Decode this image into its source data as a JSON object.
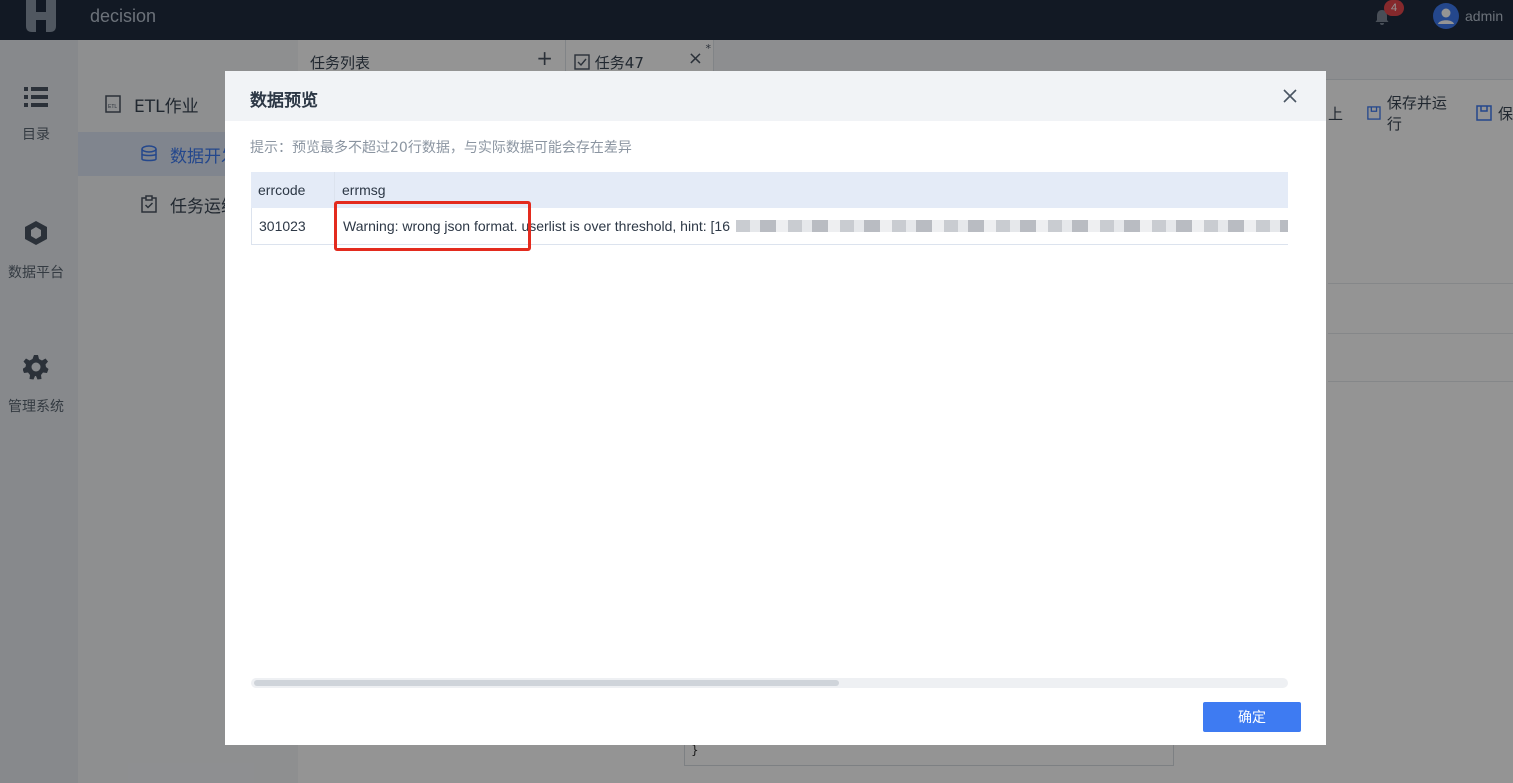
{
  "app": {
    "title": "decision",
    "notification_count": "4",
    "user_name": "admin"
  },
  "rail": [
    {
      "label": "目录",
      "icon": "list-icon"
    },
    {
      "label": "数据平台",
      "icon": "cube-icon"
    },
    {
      "label": "管理系统",
      "icon": "gear-icon"
    }
  ],
  "nav": {
    "items": [
      {
        "label": "ETL作业",
        "icon": "etl-file-icon"
      },
      {
        "label": "数据开发",
        "icon": "database-icon"
      },
      {
        "label": "任务运维",
        "icon": "clipboard-icon"
      }
    ]
  },
  "tabs": {
    "list_label": "任务列表",
    "plus": "+",
    "task_label": "任务47",
    "close": "×",
    "modified_mark": "*"
  },
  "toolbar": {
    "upload_label": "上",
    "save_run_label": "保存并运行",
    "save_label": "保"
  },
  "editor": {
    "line_text": "}"
  },
  "modal": {
    "title": "数据预览",
    "hint": "提示：预览最多不超过20行数据，与实际数据可能会存在差异",
    "columns": [
      "errcode",
      "errmsg"
    ],
    "rows": [
      {
        "errcode": "301023",
        "errmsg": "Warning: wrong json format. userlist is over threshold, hint: [16"
      }
    ],
    "ok_label": "确定"
  },
  "colors": {
    "accent": "#3e7bf2",
    "highlight": "#e32b1e",
    "topbar": "#1f2c3e"
  }
}
